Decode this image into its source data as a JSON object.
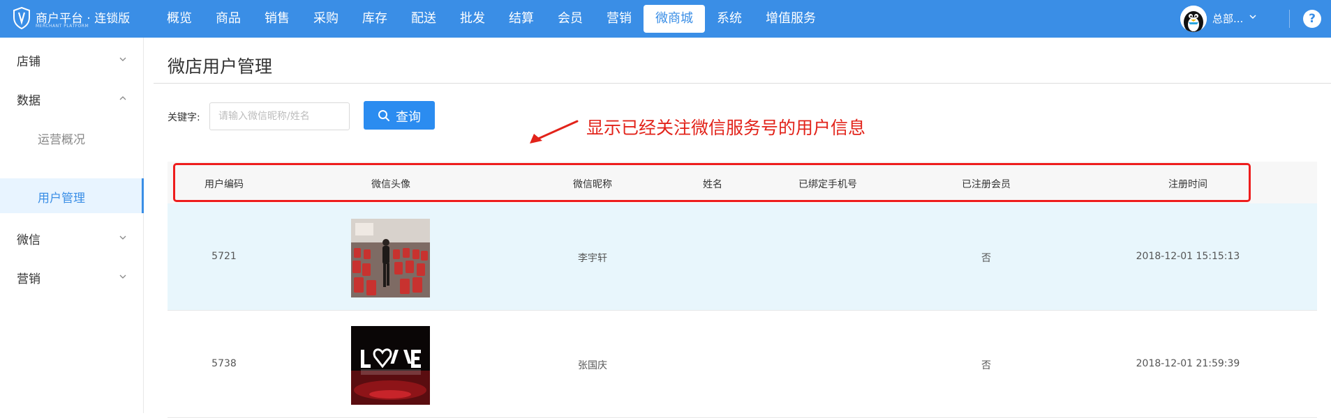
{
  "header": {
    "logo_title": "商户平台 · 连锁版",
    "logo_sub": "MERCHANT PLATFORM",
    "nav": [
      "概览",
      "商品",
      "销售",
      "采购",
      "库存",
      "配送",
      "批发",
      "结算",
      "会员",
      "营销",
      "微商城",
      "系统",
      "增值服务"
    ],
    "active_nav": "微商城",
    "user_name": "总部...",
    "help": "?"
  },
  "sidebar": {
    "items": [
      {
        "label": "店铺",
        "expanded": false
      },
      {
        "label": "数据",
        "expanded": true,
        "children": [
          "运营概况",
          "用户管理"
        ],
        "active_child": "用户管理"
      },
      {
        "label": "微信",
        "expanded": false
      },
      {
        "label": "营销",
        "expanded": false
      }
    ]
  },
  "main": {
    "title": "微店用户管理",
    "filter": {
      "keyword_label": "关键字:",
      "keyword_placeholder": "请输入微信昵称/姓名",
      "keyword_value": "",
      "search_label": "查询"
    },
    "annotation": "显示已经关注微信服务号的用户信息",
    "table": {
      "columns": [
        "用户编码",
        "微信头像",
        "微信昵称",
        "姓名",
        "已绑定手机号",
        "已注册会员",
        "注册时间"
      ],
      "rows": [
        {
          "id": "5721",
          "avatar": "photo-person-in-hall",
          "nickname": "李宇轩",
          "name": "",
          "phone": "",
          "member": "否",
          "time": "2018-12-01 15:15:13"
        },
        {
          "id": "5738",
          "avatar": "photo-love-sign",
          "nickname": "张国庆",
          "name": "",
          "phone": "",
          "member": "否",
          "time": "2018-12-01 21:59:39"
        }
      ]
    }
  },
  "colors": {
    "topbar": "#3a8ee6",
    "primary_button": "#2b8cf0",
    "annotation_red": "#e2231a",
    "selected_row": "#e8f6fc",
    "sidebar_active": "#e8f4ff"
  }
}
